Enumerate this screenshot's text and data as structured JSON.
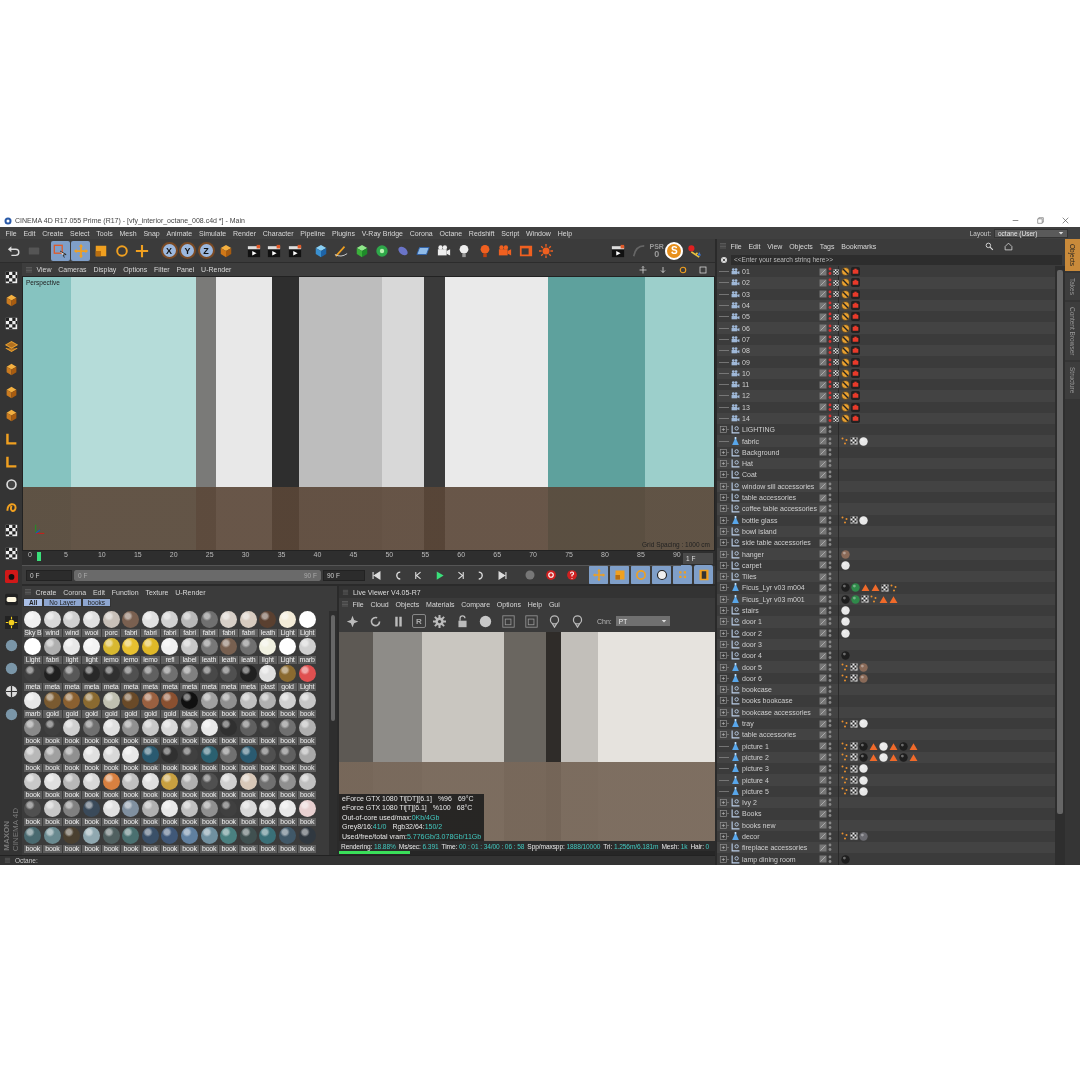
{
  "window": {
    "title": "CINEMA 4D R17.055 Prime (R17) - [vfy_interior_octane_008.c4d *] - Main"
  },
  "menu": [
    "File",
    "Edit",
    "Create",
    "Select",
    "Tools",
    "Mesh",
    "Snap",
    "Animate",
    "Simulate",
    "Render",
    "Character",
    "Pipeline",
    "Plugins",
    "V-Ray Bridge",
    "Corona",
    "Octane",
    "Redshift",
    "Script",
    "Window",
    "Help"
  ],
  "layout": {
    "label": "Layout:",
    "value": "octane (User)"
  },
  "toolbar": {
    "axis_buttons": [
      {
        "label": "X",
        "selected": true
      },
      {
        "label": "Y",
        "selected": true
      },
      {
        "label": "Z",
        "selected": true
      }
    ],
    "psr": {
      "label": "PSR",
      "value": "0"
    },
    "plugin_letter": "S"
  },
  "viewport": {
    "menu": [
      "View",
      "Cameras",
      "Display",
      "Options",
      "Filter",
      "Panel",
      "U-Render"
    ],
    "camera_label": "Perspective",
    "grid_label": "Grid Spacing : 1000 cm"
  },
  "timeline": {
    "ticks": [
      "0",
      "5",
      "10",
      "15",
      "20",
      "25",
      "30",
      "35",
      "40",
      "45",
      "50",
      "55",
      "60",
      "65",
      "70",
      "75",
      "80",
      "85",
      "90"
    ],
    "playhead": {
      "level": 0.011
    },
    "current_frame": "1 F",
    "start_field": "0 F",
    "range": {
      "start": "0 F",
      "end": "90 F",
      "level": 1
    },
    "end_field": "90 F"
  },
  "logo": [
    "MAXON",
    "CINEMA 4D"
  ],
  "material_manager": {
    "menu": [
      "Create",
      "Corona",
      "Edit",
      "Function",
      "Texture",
      "U-Render"
    ],
    "layers": [
      {
        "label": "All",
        "selected": true
      },
      {
        "label": "No Layer",
        "selected": false
      },
      {
        "label": "books",
        "selected": false
      }
    ],
    "materials": [
      {
        "label": "Sky B",
        "color": "#f0f0f0"
      },
      {
        "label": "wind",
        "color": "#d8d8d8"
      },
      {
        "label": "wind",
        "color": "#d0d0d0"
      },
      {
        "label": "wooi",
        "color": "#e0e0e0"
      },
      {
        "label": "porc",
        "color": "#c8c0b8"
      },
      {
        "label": "fabri",
        "color": "#7a6050"
      },
      {
        "label": "fabri",
        "color": "#e0e0e0"
      },
      {
        "label": "fabri",
        "color": "#d0d0d0"
      },
      {
        "label": "fabri",
        "color": "#b8b8b8"
      },
      {
        "label": "fabri",
        "color": "#707070"
      },
      {
        "label": "fabri",
        "color": "#d8d0c8"
      },
      {
        "label": "fabri",
        "color": "#d8ccc0"
      },
      {
        "label": "leath",
        "color": "#5a4030"
      },
      {
        "label": "Light",
        "color": "#f4ecd8"
      },
      {
        "label": "Light",
        "color": "#ffffff"
      },
      {
        "label": "Light",
        "color": "#ffffff"
      },
      {
        "label": "fabri",
        "color": "#b0b0b0"
      },
      {
        "label": "light",
        "color": "#e8e8e8"
      },
      {
        "label": "light",
        "color": "#f4f4f4"
      },
      {
        "label": "lemo",
        "color": "#d8b830"
      },
      {
        "label": "lemo",
        "color": "#e8c030"
      },
      {
        "label": "lemo",
        "color": "#e0b828"
      },
      {
        "label": "refl",
        "color": "#f0f0f0"
      },
      {
        "label": "label",
        "color": "#c8c8c8"
      },
      {
        "label": "leath",
        "color": "#787878"
      },
      {
        "label": "leath",
        "color": "#786050"
      },
      {
        "label": "leath",
        "color": "#707070"
      },
      {
        "label": "light",
        "color": "#f0f0e0"
      },
      {
        "label": "Light",
        "color": "#ffffff"
      },
      {
        "label": "marb",
        "color": "#d0d0d0"
      },
      {
        "label": "meta",
        "color": "#404040"
      },
      {
        "label": "meta",
        "color": "#202020"
      },
      {
        "label": "meta",
        "color": "#585858"
      },
      {
        "label": "meta",
        "color": "#282828"
      },
      {
        "label": "meta",
        "color": "#303030"
      },
      {
        "label": "meta",
        "color": "#505050"
      },
      {
        "label": "meta",
        "color": "#606060"
      },
      {
        "label": "meta",
        "color": "#707070"
      },
      {
        "label": "meta",
        "color": "#808080"
      },
      {
        "label": "meta",
        "color": "#484848"
      },
      {
        "label": "meta",
        "color": "#505050"
      },
      {
        "label": "meta",
        "color": "#202020"
      },
      {
        "label": "plast",
        "color": "#e0e0e0"
      },
      {
        "label": "gold",
        "color": "#8a6a30"
      },
      {
        "label": "Light",
        "color": "#e05050"
      },
      {
        "label": "marb",
        "color": "#e8e8e8"
      },
      {
        "label": "gold",
        "color": "#7a5a30"
      },
      {
        "label": "gold",
        "color": "#8a6030"
      },
      {
        "label": "gold",
        "color": "#8a6a30"
      },
      {
        "label": "gold",
        "color": "#c0c0b0"
      },
      {
        "label": "gold",
        "color": "#6a4a28"
      },
      {
        "label": "gold",
        "color": "#9a6040"
      },
      {
        "label": "gold",
        "color": "#8a5030"
      },
      {
        "label": "black",
        "color": "#101010"
      },
      {
        "label": "book",
        "color": "#a0a0a0"
      },
      {
        "label": "book",
        "color": "#909090"
      },
      {
        "label": "book",
        "color": "#c0c0c0"
      },
      {
        "label": "book",
        "color": "#b0b0b0"
      },
      {
        "label": "book",
        "color": "#d0d0d0"
      },
      {
        "label": "book",
        "color": "#c8c8c8"
      },
      {
        "label": "book",
        "color": "#8a8a8a"
      },
      {
        "label": "book",
        "color": "#404040"
      },
      {
        "label": "book",
        "color": "#d0d0d0"
      },
      {
        "label": "book",
        "color": "#707070"
      },
      {
        "label": "book",
        "color": "#e0e0e0"
      },
      {
        "label": "book",
        "color": "#909090"
      },
      {
        "label": "book",
        "color": "#c8c8c8"
      },
      {
        "label": "book",
        "color": "#d8d8d8"
      },
      {
        "label": "book",
        "color": "#a8a8a8"
      },
      {
        "label": "book",
        "color": "#e8e8e8"
      },
      {
        "label": "book",
        "color": "#303030"
      },
      {
        "label": "book",
        "color": "#606060"
      },
      {
        "label": "book",
        "color": "#404040"
      },
      {
        "label": "book",
        "color": "#707070"
      },
      {
        "label": "book",
        "color": "#b0b0b0"
      },
      {
        "label": "book",
        "color": "#b8b8b8"
      },
      {
        "label": "book",
        "color": "#a0a0a0"
      },
      {
        "label": "book",
        "color": "#909090"
      },
      {
        "label": "book",
        "color": "#e0e0e0"
      },
      {
        "label": "book",
        "color": "#d8d8d8"
      },
      {
        "label": "book",
        "color": "#e8e8e8"
      },
      {
        "label": "book",
        "color": "#2a5a70"
      },
      {
        "label": "book",
        "color": "#303030"
      },
      {
        "label": "book",
        "color": "#404040"
      },
      {
        "label": "book",
        "color": "#2a6070"
      },
      {
        "label": "book",
        "color": "#707070"
      },
      {
        "label": "book",
        "color": "#2a5a70"
      },
      {
        "label": "book",
        "color": "#505050"
      },
      {
        "label": "book",
        "color": "#606060"
      },
      {
        "label": "book",
        "color": "#a8a8a8"
      },
      {
        "label": "book",
        "color": "#c8c8c8"
      },
      {
        "label": "book",
        "color": "#e0e0e0"
      },
      {
        "label": "book",
        "color": "#b8b8b8"
      },
      {
        "label": "book",
        "color": "#d8d8d8"
      },
      {
        "label": "book",
        "color": "#d88040"
      },
      {
        "label": "book",
        "color": "#c0c0c0"
      },
      {
        "label": "book",
        "color": "#e0e0e0"
      },
      {
        "label": "book",
        "color": "#c8a040"
      },
      {
        "label": "book",
        "color": "#b0b0b0"
      },
      {
        "label": "book",
        "color": "#505050"
      },
      {
        "label": "book",
        "color": "#d0d0d0"
      },
      {
        "label": "book",
        "color": "#d8c8b8"
      },
      {
        "label": "book",
        "color": "#707070"
      },
      {
        "label": "book",
        "color": "#909090"
      },
      {
        "label": "book",
        "color": "#c0c0c0"
      },
      {
        "label": "book",
        "color": "#505050"
      },
      {
        "label": "book",
        "color": "#c8c8c8"
      },
      {
        "label": "book",
        "color": "#808080"
      },
      {
        "label": "book",
        "color": "#3a4a5a"
      },
      {
        "label": "book",
        "color": "#e0e0e0"
      },
      {
        "label": "book",
        "color": "#8090a0"
      },
      {
        "label": "book",
        "color": "#b0b0b0"
      },
      {
        "label": "book",
        "color": "#e8e8e8"
      },
      {
        "label": "book",
        "color": "#c0c0c0"
      },
      {
        "label": "book",
        "color": "#909090"
      },
      {
        "label": "book",
        "color": "#404040"
      },
      {
        "label": "book",
        "color": "#d8d8d8"
      },
      {
        "label": "book",
        "color": "#e0e0e0"
      },
      {
        "label": "book",
        "color": "#e8e8e8"
      },
      {
        "label": "book",
        "color": "#e8d0d0"
      },
      {
        "label": "book",
        "color": "#4a6a70"
      },
      {
        "label": "book",
        "color": "#6a8a90"
      },
      {
        "label": "book",
        "color": "#4a4030"
      },
      {
        "label": "book",
        "color": "#90a8b0"
      },
      {
        "label": "book",
        "color": "#506060"
      },
      {
        "label": "book",
        "color": "#4a7070"
      },
      {
        "label": "book",
        "color": "#3a5068"
      },
      {
        "label": "book",
        "color": "#405878"
      },
      {
        "label": "book",
        "color": "#6080a0"
      },
      {
        "label": "book",
        "color": "#7090a0"
      },
      {
        "label": "book",
        "color": "#4a8080"
      },
      {
        "label": "book",
        "color": "#405050"
      },
      {
        "label": "book",
        "color": "#3a7078"
      },
      {
        "label": "book",
        "color": "#405868"
      },
      {
        "label": "book",
        "color": "#303840"
      }
    ]
  },
  "live_viewer": {
    "title": "Live Viewer V4.05-R7",
    "menu": [
      "File",
      "Cloud",
      "Objects",
      "Materials",
      "Compare",
      "Options",
      "Help",
      "Gui"
    ],
    "render_button": "R",
    "channel_label": "Chn:",
    "channel_value": "PT",
    "stats": [
      {
        "cells": [
          {
            "label": "eForce GTX 1080 Ti[DT][6.1]"
          },
          {
            "label": "%96"
          },
          {
            "label": "69°C"
          }
        ]
      },
      {
        "cells": [
          {
            "label": "eForce GTX 1080 Ti[T][6.1]"
          },
          {
            "label": "%100"
          },
          {
            "label": "68°C"
          }
        ]
      },
      {
        "cells": [
          {
            "label": "Out-of-core used/max:",
            "value": "0Kb/4Gb"
          }
        ]
      },
      {
        "cells": [
          {
            "label": "Grey8/16:",
            "value": "41/0"
          },
          {
            "label": "Rgb32/64:",
            "value": "150/2"
          }
        ]
      },
      {
        "cells": [
          {
            "label": "Used/free/total vram:",
            "value": "5.776Gb/3.078Gb/11Gb"
          }
        ]
      }
    ],
    "status": [
      {
        "label": "Rendering:",
        "value": "18.88%"
      },
      {
        "label": "Ms/sec:",
        "value": "6.391"
      },
      {
        "label": "Time:",
        "value": "00 : 01 : 34/00 : 06 : 58"
      },
      {
        "label": "Spp/maxspp:",
        "value": "1888/10000"
      },
      {
        "label": "Tri:",
        "value": "1.256m/6.181m"
      },
      {
        "label": "Mesh:",
        "value": "1k"
      },
      {
        "label": "Hair:",
        "value": "0"
      }
    ],
    "progress": {
      "level": 0.1888
    }
  },
  "status_bar": {
    "text": "Octane:"
  },
  "object_manager": {
    "menu": [
      "File",
      "Edit",
      "View",
      "Objects",
      "Tags",
      "Bookmarks"
    ],
    "search": {
      "placeholder": "<<Enter your search string here>>"
    },
    "objects": [
      {
        "name": "01",
        "kind": "camera",
        "expandable": false,
        "tags": [
          {
            "kind": "prohibit"
          },
          {
            "kind": "camera"
          }
        ]
      },
      {
        "name": "02",
        "kind": "camera",
        "expandable": false,
        "tags": [
          {
            "kind": "prohibit"
          },
          {
            "kind": "camera"
          }
        ]
      },
      {
        "name": "03",
        "kind": "camera",
        "expandable": false,
        "tags": [
          {
            "kind": "prohibit"
          },
          {
            "kind": "camera"
          }
        ]
      },
      {
        "name": "04",
        "kind": "camera",
        "expandable": false,
        "tags": [
          {
            "kind": "prohibit"
          },
          {
            "kind": "camera"
          }
        ]
      },
      {
        "name": "05",
        "kind": "camera",
        "expandable": false,
        "tags": [
          {
            "kind": "prohibit"
          },
          {
            "kind": "camera"
          }
        ]
      },
      {
        "name": "06",
        "kind": "camera",
        "expandable": false,
        "tags": [
          {
            "kind": "prohibit"
          },
          {
            "kind": "camera"
          }
        ]
      },
      {
        "name": "07",
        "kind": "camera",
        "expandable": false,
        "tags": [
          {
            "kind": "prohibit"
          },
          {
            "kind": "camera"
          }
        ]
      },
      {
        "name": "08",
        "kind": "camera",
        "expandable": false,
        "tags": [
          {
            "kind": "prohibit"
          },
          {
            "kind": "camera"
          }
        ]
      },
      {
        "name": "09",
        "kind": "camera",
        "expandable": false,
        "tags": [
          {
            "kind": "prohibit"
          },
          {
            "kind": "camera"
          }
        ]
      },
      {
        "name": "10",
        "kind": "camera",
        "expandable": false,
        "tags": [
          {
            "kind": "prohibit"
          },
          {
            "kind": "camera"
          }
        ]
      },
      {
        "name": "11",
        "kind": "camera",
        "expandable": false,
        "tags": [
          {
            "kind": "prohibit"
          },
          {
            "kind": "camera"
          }
        ]
      },
      {
        "name": "12",
        "kind": "camera",
        "expandable": false,
        "tags": [
          {
            "kind": "prohibit"
          },
          {
            "kind": "camera"
          }
        ]
      },
      {
        "name": "13",
        "kind": "camera",
        "expandable": false,
        "tags": [
          {
            "kind": "prohibit"
          },
          {
            "kind": "camera"
          }
        ]
      },
      {
        "name": "14",
        "kind": "camera",
        "expandable": false,
        "tags": [
          {
            "kind": "prohibit"
          },
          {
            "kind": "camera"
          }
        ]
      },
      {
        "name": "LIGHTING",
        "kind": "null",
        "expandable": true
      },
      {
        "name": "fabric",
        "kind": "polygon",
        "expandable": false,
        "tags": [
          {
            "kind": "dots"
          },
          {
            "kind": "checker"
          },
          {
            "kind": "ball-light"
          }
        ]
      },
      {
        "name": "Background",
        "kind": "null",
        "expandable": true
      },
      {
        "name": "Hat",
        "kind": "null",
        "expandable": true
      },
      {
        "name": "Coat",
        "kind": "null",
        "expandable": true
      },
      {
        "name": "window sill accessories",
        "kind": "null",
        "expandable": true
      },
      {
        "name": "table accessories",
        "kind": "null",
        "expandable": true
      },
      {
        "name": "coffee table accessories",
        "kind": "null",
        "expandable": true
      },
      {
        "name": "bottle glass",
        "kind": "polygon",
        "expandable": true,
        "tags": [
          {
            "kind": "dots"
          },
          {
            "kind": "checker"
          },
          {
            "kind": "ball-light"
          }
        ]
      },
      {
        "name": "bowl island",
        "kind": "null",
        "expandable": true
      },
      {
        "name": "side table accessories",
        "kind": "null",
        "expandable": true
      },
      {
        "name": "hanger",
        "kind": "null",
        "expandable": true,
        "tags": [
          {
            "kind": "ball-brown"
          }
        ]
      },
      {
        "name": "carpet",
        "kind": "null",
        "expandable": true,
        "tags": [
          {
            "kind": "ball-light"
          }
        ]
      },
      {
        "name": "Tiles",
        "kind": "null",
        "expandable": true
      },
      {
        "name": "Ficus_Lyr v03 m004",
        "kind": "polygon",
        "expandable": true,
        "tags": [
          {
            "kind": "ball-dark"
          },
          {
            "kind": "ball-green"
          },
          {
            "kind": "triangle"
          },
          {
            "kind": "triangle"
          },
          {
            "kind": "checker"
          },
          {
            "kind": "dots"
          }
        ]
      },
      {
        "name": "Ficus_Lyr v03 m001",
        "kind": "polygon",
        "expandable": true,
        "tags": [
          {
            "kind": "ball-dark"
          },
          {
            "kind": "ball-green"
          },
          {
            "kind": "checker"
          },
          {
            "kind": "dots"
          },
          {
            "kind": "triangle"
          },
          {
            "kind": "triangle"
          }
        ]
      },
      {
        "name": "stairs",
        "kind": "null",
        "expandable": true,
        "tags": [
          {
            "kind": "ball-light"
          }
        ]
      },
      {
        "name": "door 1",
        "kind": "null",
        "expandable": true,
        "tags": [
          {
            "kind": "ball-light"
          }
        ]
      },
      {
        "name": "door 2",
        "kind": "null",
        "expandable": true,
        "tags": [
          {
            "kind": "ball-light"
          }
        ]
      },
      {
        "name": "door 3",
        "kind": "null",
        "expandable": true
      },
      {
        "name": "door 4",
        "kind": "null",
        "expandable": true,
        "tags": [
          {
            "kind": "ball-dark"
          }
        ]
      },
      {
        "name": "door 5",
        "kind": "polygon",
        "expandable": true,
        "tags": [
          {
            "kind": "dots"
          },
          {
            "kind": "checker"
          },
          {
            "kind": "ball-brown"
          }
        ]
      },
      {
        "name": "door 6",
        "kind": "polygon",
        "expandable": true,
        "tags": [
          {
            "kind": "dots"
          },
          {
            "kind": "checker"
          },
          {
            "kind": "ball-brown"
          }
        ]
      },
      {
        "name": "bookcase",
        "kind": "null",
        "expandable": true
      },
      {
        "name": "books  bookcase",
        "kind": "null",
        "expandable": true
      },
      {
        "name": "bookcase  accessories",
        "kind": "null",
        "expandable": true
      },
      {
        "name": "tray",
        "kind": "polygon",
        "expandable": true,
        "tags": [
          {
            "kind": "dots"
          },
          {
            "kind": "checker"
          },
          {
            "kind": "ball-light"
          }
        ]
      },
      {
        "name": "table accessories",
        "kind": "null",
        "expandable": true
      },
      {
        "name": "picture 1",
        "kind": "polygon",
        "expandable": false,
        "tags": [
          {
            "kind": "dots"
          },
          {
            "kind": "checker"
          },
          {
            "kind": "ball-dark"
          },
          {
            "kind": "triangle"
          },
          {
            "kind": "ball-light"
          },
          {
            "kind": "triangle"
          },
          {
            "kind": "ball-dark"
          },
          {
            "kind": "triangle"
          }
        ]
      },
      {
        "name": "picture 2",
        "kind": "polygon",
        "expandable": false,
        "tags": [
          {
            "kind": "dots"
          },
          {
            "kind": "checker"
          },
          {
            "kind": "ball-dark"
          },
          {
            "kind": "triangle"
          },
          {
            "kind": "ball-light"
          },
          {
            "kind": "triangle"
          },
          {
            "kind": "ball-dark"
          },
          {
            "kind": "triangle"
          }
        ]
      },
      {
        "name": "picture 3",
        "kind": "polygon",
        "expandable": false,
        "tags": [
          {
            "kind": "dots"
          },
          {
            "kind": "checker"
          },
          {
            "kind": "ball-light"
          }
        ]
      },
      {
        "name": "picture 4",
        "kind": "polygon",
        "expandable": false,
        "tags": [
          {
            "kind": "dots"
          },
          {
            "kind": "checker"
          },
          {
            "kind": "ball-light"
          }
        ]
      },
      {
        "name": "picture 5",
        "kind": "polygon",
        "expandable": false,
        "tags": [
          {
            "kind": "dots"
          },
          {
            "kind": "checker"
          },
          {
            "kind": "ball-light"
          }
        ]
      },
      {
        "name": "Ivy 2",
        "kind": "null",
        "expandable": true
      },
      {
        "name": "Books",
        "kind": "null",
        "expandable": true
      },
      {
        "name": "books new",
        "kind": "null",
        "expandable": true
      },
      {
        "name": "decor",
        "kind": "polygon",
        "expandable": true,
        "tags": [
          {
            "kind": "dots"
          },
          {
            "kind": "checker"
          },
          {
            "kind": "ball-gray"
          }
        ]
      },
      {
        "name": "fireplace accessories",
        "kind": "null",
        "expandable": true
      },
      {
        "name": "lamp dining room",
        "kind": "null",
        "expandable": true,
        "tags": [
          {
            "kind": "ball-dark"
          }
        ]
      }
    ]
  },
  "side_tabs": [
    {
      "label": "Objects",
      "selected": true
    },
    {
      "label": "Takes",
      "selected": false
    },
    {
      "label": "Content Browser",
      "selected": false
    },
    {
      "label": "Structure",
      "selected": false
    }
  ]
}
